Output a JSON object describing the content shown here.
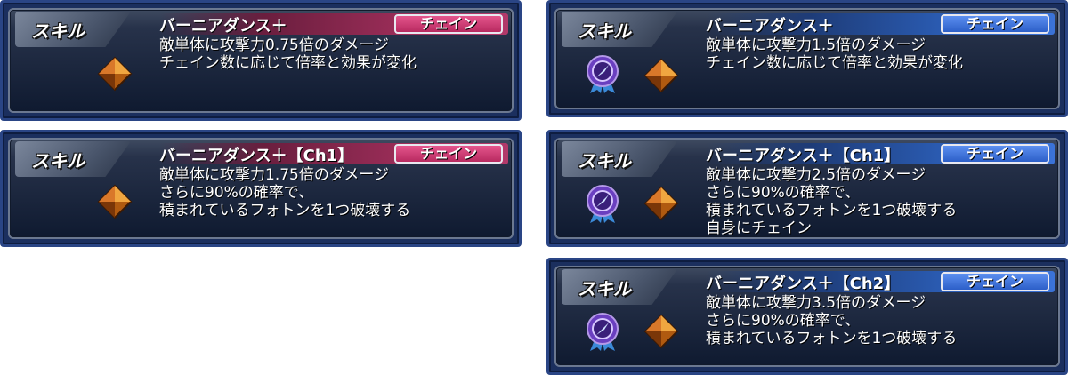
{
  "skill_label": "スキル",
  "chain_label": "チェイン",
  "cards": [
    {
      "title": "バーニアダンス＋",
      "lines": [
        "敵単体に攻撃力0.75倍のダメージ",
        "チェイン数に応じて倍率と効果が変化"
      ]
    },
    {
      "title": "バーニアダンス＋【Ch1】",
      "lines": [
        "敵単体に攻撃力1.75倍のダメージ",
        "さらに90%の確率で、",
        "積まれているフォトンを1つ破壊する"
      ]
    },
    {
      "title": "バーニアダンス＋",
      "lines": [
        "敵単体に攻撃力1.5倍のダメージ",
        "チェイン数に応じて倍率と効果が変化"
      ]
    },
    {
      "title": "バーニアダンス＋【Ch1】",
      "lines": [
        "敵単体に攻撃力2.5倍のダメージ",
        "さらに90%の確率で、",
        "積まれているフォトンを1つ破壊する",
        "自身にチェイン"
      ]
    },
    {
      "title": "バーニアダンス＋【Ch2】",
      "lines": [
        "敵単体に攻撃力3.5倍のダメージ",
        "さらに90%の確率で、",
        "積まれているフォトンを1つ破壊する"
      ]
    }
  ],
  "colors": {
    "red_chain": "#c8336b",
    "blue_chain": "#3a6fd8",
    "panel": "#1b2f5e"
  },
  "icons": {
    "gem": "orange-diamond-photon-icon",
    "medal": "purple-medal-icon"
  }
}
